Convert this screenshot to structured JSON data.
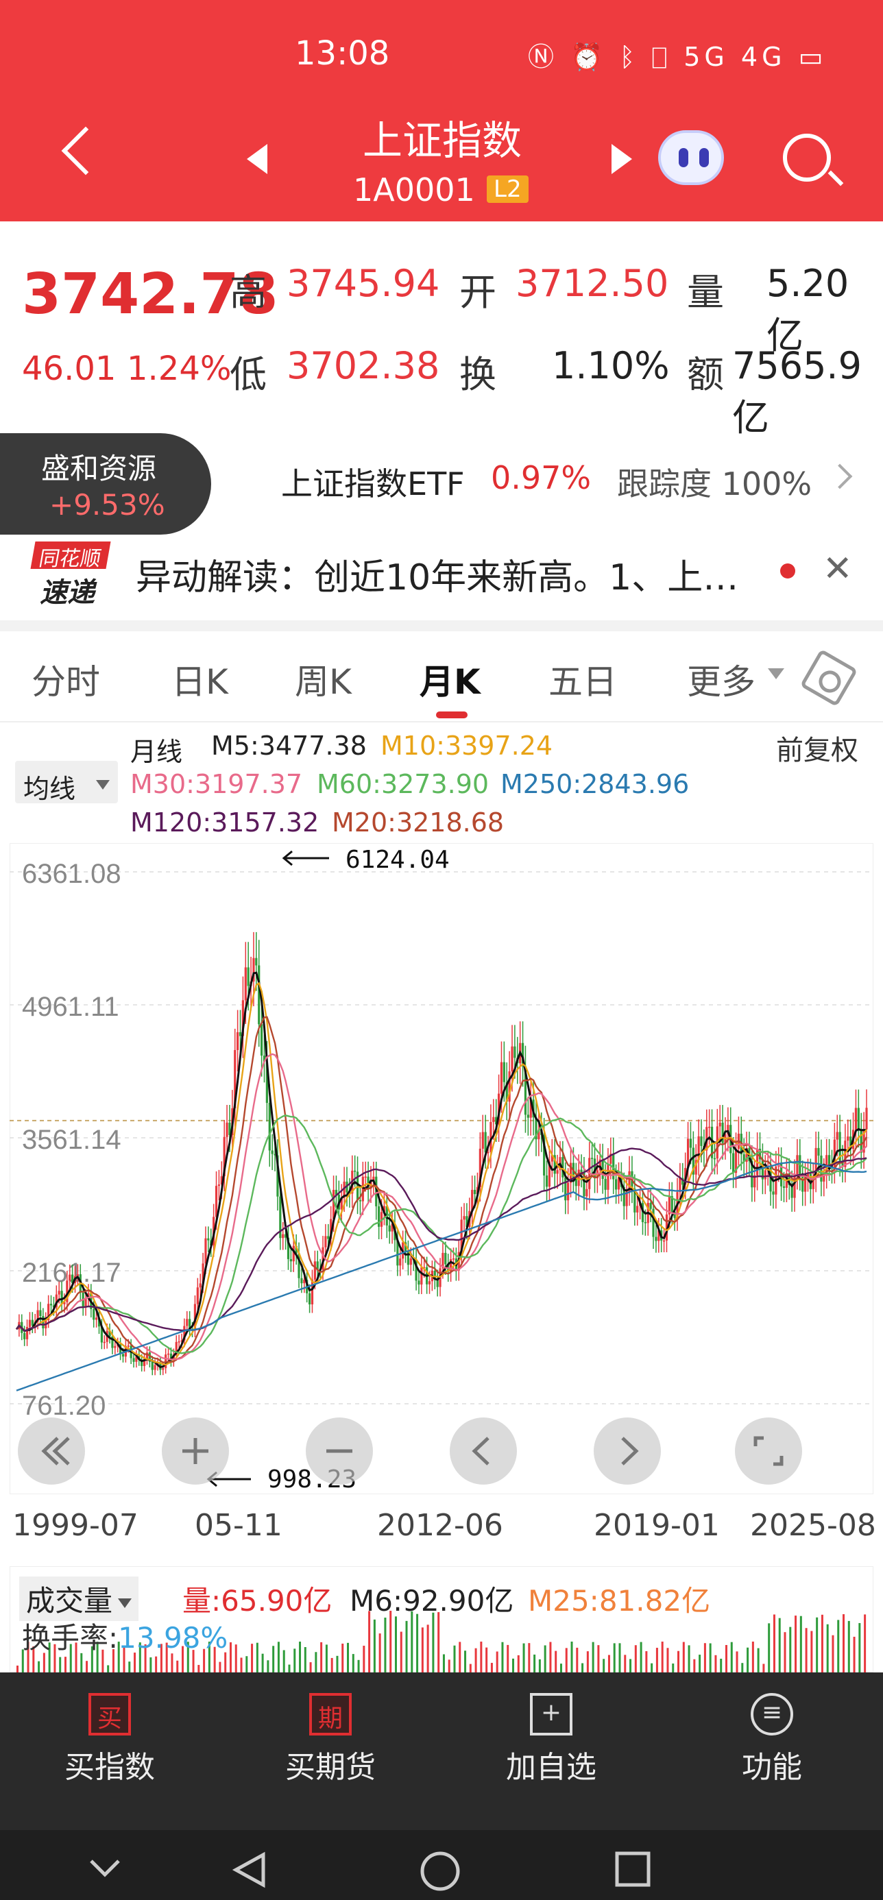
{
  "status_bar": {
    "time": "13:08",
    "icons": "Ⓝ ⏰ ᛒ ⎕ 5G 4G ▭"
  },
  "header": {
    "title": "上证指数",
    "code": "1A0001",
    "level_badge": "L2"
  },
  "quote": {
    "price": "3742.78",
    "change": "46.01",
    "change_pct": "1.24%",
    "high_label": "高",
    "high": "3745.94",
    "open_label": "开",
    "open": "3712.50",
    "volume_label": "量",
    "volume": "5.20亿",
    "low_label": "低",
    "low": "3702.38",
    "turnover_label": "换",
    "turnover": "1.10%",
    "amount_label": "额",
    "amount": "7565.9亿"
  },
  "hot_stock": {
    "name": "盛和资源",
    "change": "+9.53%"
  },
  "etf": {
    "name": "上证指数ETF",
    "change": "0.97%",
    "tracking_label": "跟踪度",
    "tracking": "100%"
  },
  "news": {
    "logo_top": "同花顺",
    "logo_bottom": "速递",
    "text": "异动解读：创近10年来新高。1、上…",
    "close": "✕"
  },
  "tabs": [
    {
      "label": "分时"
    },
    {
      "label": "日K"
    },
    {
      "label": "周K"
    },
    {
      "label": "月K"
    },
    {
      "label": "五日"
    },
    {
      "label": "更多"
    }
  ],
  "ma": {
    "button": "均线",
    "period_label": "月线",
    "m5": "M5:3477.38",
    "m10": "M10:3397.24",
    "m30": "M30:3197.37",
    "m60": "M60:3273.90",
    "m250": "M250:2843.96",
    "m120": "M120:3157.32",
    "m20": "M20:3218.68",
    "adjust": "前复权",
    "colors": {
      "m5": "#111111",
      "m10": "#e8a317",
      "m30": "#e86a8a",
      "m60": "#5cb85c",
      "m250": "#2a7ab0",
      "m120": "#5a1a5a",
      "m20": "#b5482e"
    }
  },
  "chart_data": {
    "type": "line",
    "title": "",
    "x": [
      "1999-07",
      "05-11",
      "2012-06",
      "2019-01",
      "2025-08"
    ],
    "y_ticks": [
      "6361.08",
      "4961.11",
      "3561.14",
      "2161.17",
      "761.20"
    ],
    "ylim": [
      761.2,
      6361.08
    ],
    "annotations": [
      {
        "label": "6124.04",
        "type": "max"
      },
      {
        "label": "998.23",
        "type": "min"
      }
    ],
    "series": [
      {
        "name": "M5",
        "values": [
          1500,
          1700,
          2100,
          1450,
          1250,
          1150,
          1650,
          3200,
          5600,
          2600,
          1900,
          3000,
          3100,
          2400,
          2050,
          2300,
          3500,
          4500,
          3300,
          3100,
          3250,
          2950,
          2500,
          3400,
          3600,
          3300,
          3100,
          3150,
          3400,
          3742
        ]
      }
    ]
  },
  "volume": {
    "button": "成交量",
    "vol": "量:65.90亿",
    "m6": "M6:92.90亿",
    "m25": "M25:81.82亿",
    "turnover_label": "换手率:",
    "turnover": "13.98%"
  },
  "bottom_bar": [
    {
      "icon": "买",
      "label": "买指数"
    },
    {
      "icon": "期",
      "label": "买期货"
    },
    {
      "icon": "+",
      "label": "加自选"
    },
    {
      "icon": "≡",
      "label": "功能"
    }
  ]
}
